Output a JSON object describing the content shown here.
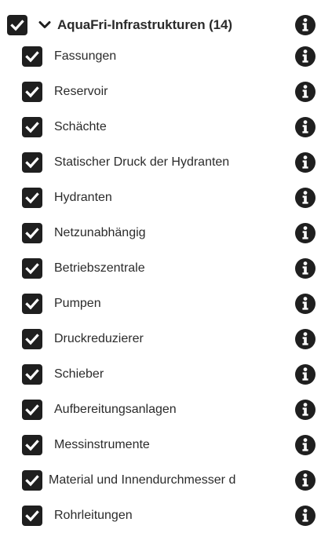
{
  "group": {
    "title": "AquaFri-Infrastrukturen (14)",
    "checked": true,
    "expanded": true
  },
  "layers": [
    {
      "label": "Fassungen",
      "checked": true
    },
    {
      "label": "Reservoir",
      "checked": true
    },
    {
      "label": "Schächte",
      "checked": true
    },
    {
      "label": "Statischer Druck der Hydranten",
      "checked": true
    },
    {
      "label": "Hydranten",
      "checked": true
    },
    {
      "label": "Netzunabhängig",
      "checked": true
    },
    {
      "label": "Betriebszentrale",
      "checked": true
    },
    {
      "label": "Pumpen",
      "checked": true
    },
    {
      "label": "Druckreduzierer",
      "checked": true
    },
    {
      "label": "Schieber",
      "checked": true
    },
    {
      "label": "Aufbereitungsanlagen",
      "checked": true
    },
    {
      "label": "Messinstrumente",
      "checked": true
    },
    {
      "label": "Material und Innendurchmesser d",
      "checked": true
    },
    {
      "label": "Rohrleitungen",
      "checked": true
    }
  ],
  "icons": {
    "checkbox": "checkbox-checked-icon",
    "expand": "chevron-down-icon",
    "info": "info-circle-icon"
  },
  "colors": {
    "icon": "#1f1f1f",
    "text": "#2b2b2b",
    "background": "#ffffff"
  }
}
